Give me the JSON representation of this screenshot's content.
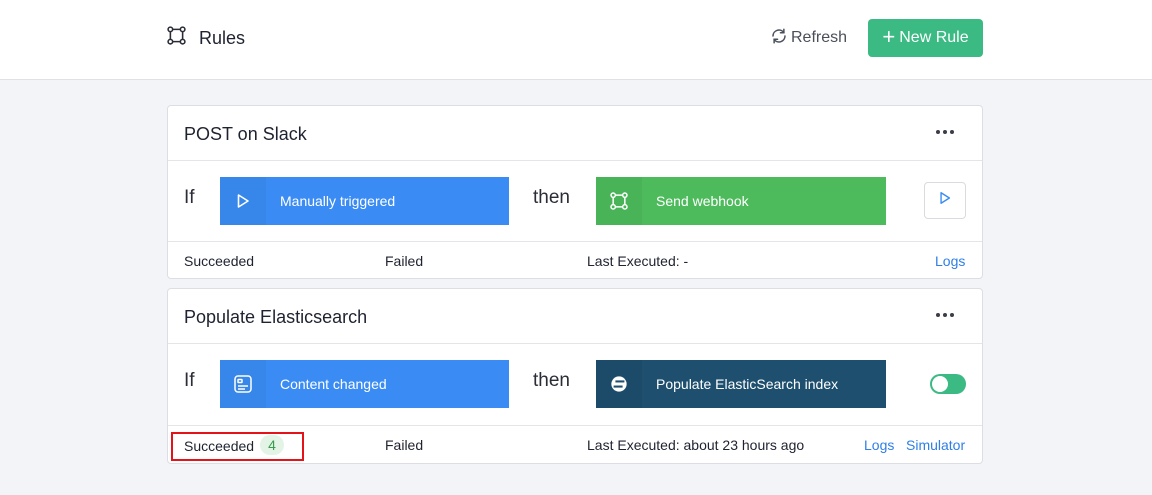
{
  "header": {
    "title": "Rules",
    "refresh_label": "Refresh",
    "new_rule_label": "New Rule"
  },
  "rules": [
    {
      "name": "POST on Slack",
      "if_label": "If",
      "then_label": "then",
      "trigger": {
        "label": "Manually triggered",
        "icon": "play-icon",
        "color": "#3a8cf4"
      },
      "action": {
        "label": "Send webhook",
        "icon": "webhook-icon",
        "color": "#4dbb5c"
      },
      "control": "run-button",
      "footer": {
        "succeeded_label": "Succeeded",
        "failed_label": "Failed",
        "last_executed": "Last Executed: -",
        "logs_label": "Logs"
      }
    },
    {
      "name": "Populate Elasticsearch",
      "if_label": "If",
      "then_label": "then",
      "trigger": {
        "label": "Content changed",
        "icon": "content-icon",
        "color": "#3a8cf4"
      },
      "action": {
        "label": "Populate ElasticSearch index",
        "icon": "elasticsearch-icon",
        "color": "#1e4f6e"
      },
      "control": "enabled-toggle",
      "enabled": true,
      "footer": {
        "succeeded_label": "Succeeded",
        "succeeded_count": "4",
        "failed_label": "Failed",
        "last_executed": "Last Executed: about 23 hours ago",
        "logs_label": "Logs",
        "simulator_label": "Simulator"
      }
    }
  ],
  "colors": {
    "accent_green": "#3cba84",
    "link_blue": "#2f7fe6",
    "highlight_red": "#e4131a"
  }
}
